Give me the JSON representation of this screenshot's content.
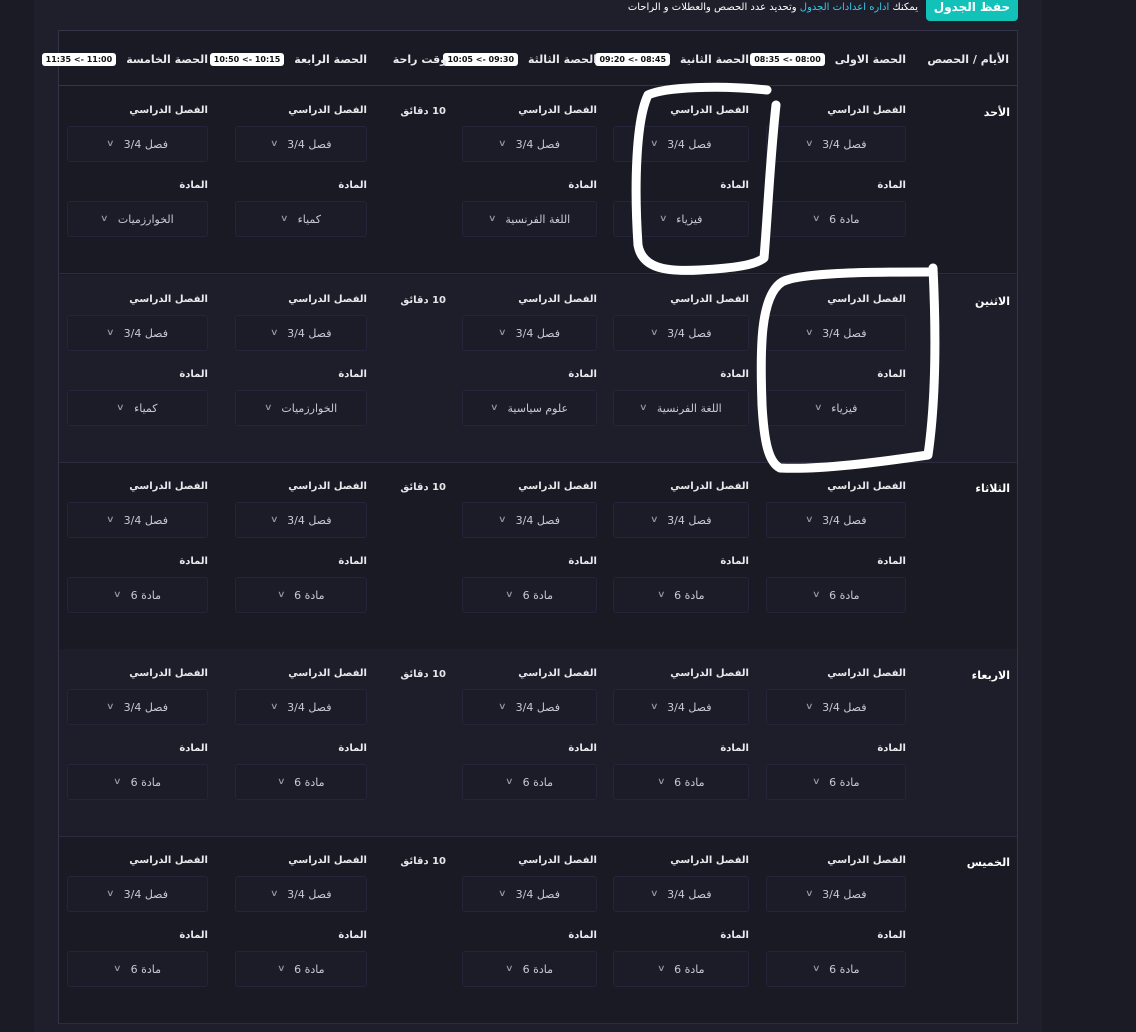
{
  "toolbar": {
    "save_label": "حفظ الجدول",
    "hint_prefix": "يمكنك ",
    "hint_link": "اداره اعدادات الجدول",
    "hint_suffix": " وتحديد عدد الحصص والعطلات و الراحات"
  },
  "header": {
    "days_col": "الأيام / الحصص",
    "periods": [
      {
        "label": "الحصة الاولى",
        "time": "08:35 <- 08:00"
      },
      {
        "label": "الحصة الثانية",
        "time": "09:20 <- 08:45"
      },
      {
        "label": "الحصة الثالثة",
        "time": "10:05 <- 09:30"
      },
      {
        "label": "الحصة الرابعة",
        "time": "10:50 <- 10:15"
      },
      {
        "label": "الحصة الخامسة",
        "time": "11:35 <- 11:00"
      }
    ],
    "break_col": "وقت راحة"
  },
  "labels": {
    "class": "الفصل الدراسي",
    "subject": "المادة"
  },
  "days": [
    {
      "name": "الأحد",
      "break": "10 دقائق",
      "slots": [
        {
          "class": "فصل 3/4",
          "subject": "مادة 6"
        },
        {
          "class": "فصل 3/4",
          "subject": "فيزياء"
        },
        {
          "class": "فصل 3/4",
          "subject": "اللغة الفرنسية"
        },
        {
          "class": "فصل 3/4",
          "subject": "كمياء"
        },
        {
          "class": "فصل 3/4",
          "subject": "الخوارزميات"
        }
      ]
    },
    {
      "name": "الاثنين",
      "break": "10 دقائق",
      "slots": [
        {
          "class": "فصل 3/4",
          "subject": "فيزياء"
        },
        {
          "class": "فصل 3/4",
          "subject": "اللغة الفرنسية"
        },
        {
          "class": "فصل 3/4",
          "subject": "علوم سياسية"
        },
        {
          "class": "فصل 3/4",
          "subject": "الخوارزميات"
        },
        {
          "class": "فصل 3/4",
          "subject": "كمياء"
        }
      ]
    },
    {
      "name": "الثلاثاء",
      "break": "10 دقائق",
      "slots": [
        {
          "class": "فصل 3/4",
          "subject": "مادة 6"
        },
        {
          "class": "فصل 3/4",
          "subject": "مادة 6"
        },
        {
          "class": "فصل 3/4",
          "subject": "مادة 6"
        },
        {
          "class": "فصل 3/4",
          "subject": "مادة 6"
        },
        {
          "class": "فصل 3/4",
          "subject": "مادة 6"
        }
      ]
    },
    {
      "name": "الاربعاء",
      "break": "10 دقائق",
      "slots": [
        {
          "class": "فصل 3/4",
          "subject": "مادة 6"
        },
        {
          "class": "فصل 3/4",
          "subject": "مادة 6"
        },
        {
          "class": "فصل 3/4",
          "subject": "مادة 6"
        },
        {
          "class": "فصل 3/4",
          "subject": "مادة 6"
        },
        {
          "class": "فصل 3/4",
          "subject": "مادة 6"
        }
      ]
    },
    {
      "name": "الخميس",
      "break": "10 دقائق",
      "slots": [
        {
          "class": "فصل 3/4",
          "subject": "مادة 6"
        },
        {
          "class": "فصل 3/4",
          "subject": "مادة 6"
        },
        {
          "class": "فصل 3/4",
          "subject": "مادة 6"
        },
        {
          "class": "فصل 3/4",
          "subject": "مادة 6"
        },
        {
          "class": "فصل 3/4",
          "subject": "مادة 6"
        }
      ]
    }
  ],
  "annotation_color": "#ffffff"
}
